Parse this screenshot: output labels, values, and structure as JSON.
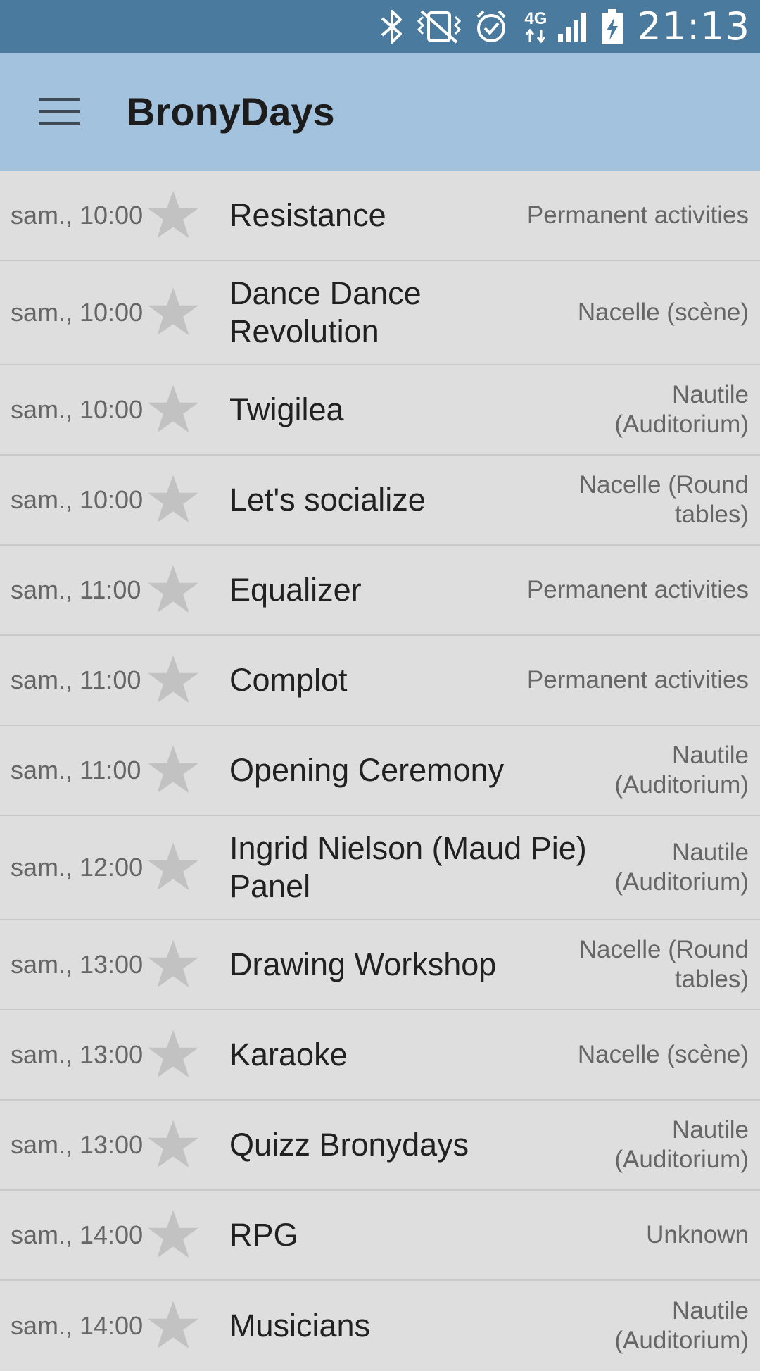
{
  "status_bar": {
    "icons": [
      "bluetooth-icon",
      "vibrate-icon",
      "alarm-icon",
      "network-4g-icon",
      "signal-icon",
      "battery-charging-icon"
    ],
    "network_label": "4G",
    "time": "21:13"
  },
  "app_bar": {
    "menu_icon": "hamburger-menu-icon",
    "title": "BronyDays"
  },
  "colors": {
    "status_bar": "#4a7a9e",
    "app_bar": "#a2c2dd",
    "list_background": "#dedede",
    "divider": "#cacaca",
    "star": "#c2c2c2"
  },
  "events": [
    {
      "time": "sam., 10:00",
      "title": "Resistance",
      "location": "Permanent activities"
    },
    {
      "time": "sam., 10:00",
      "title": "Dance Dance Revolution",
      "location": "Nacelle (scène)"
    },
    {
      "time": "sam., 10:00",
      "title": "Twigilea",
      "location": "Nautile (Auditorium)"
    },
    {
      "time": "sam., 10:00",
      "title": "Let's socialize",
      "location": "Nacelle (Round tables)"
    },
    {
      "time": "sam., 11:00",
      "title": "Equalizer",
      "location": "Permanent activities"
    },
    {
      "time": "sam., 11:00",
      "title": "Complot",
      "location": "Permanent activities"
    },
    {
      "time": "sam., 11:00",
      "title": "Opening Ceremony",
      "location": "Nautile (Auditorium)"
    },
    {
      "time": "sam., 12:00",
      "title": "Ingrid Nielson (Maud Pie) Panel",
      "location": "Nautile (Auditorium)"
    },
    {
      "time": "sam., 13:00",
      "title": "Drawing Workshop",
      "location": "Nacelle (Round tables)"
    },
    {
      "time": "sam., 13:00",
      "title": "Karaoke",
      "location": "Nacelle (scène)"
    },
    {
      "time": "sam., 13:00",
      "title": "Quizz Bronydays",
      "location": "Nautile (Auditorium)"
    },
    {
      "time": "sam., 14:00",
      "title": "RPG",
      "location": "Unknown"
    },
    {
      "time": "sam., 14:00",
      "title": "Musicians",
      "location": "Nautile (Auditorium)"
    }
  ]
}
